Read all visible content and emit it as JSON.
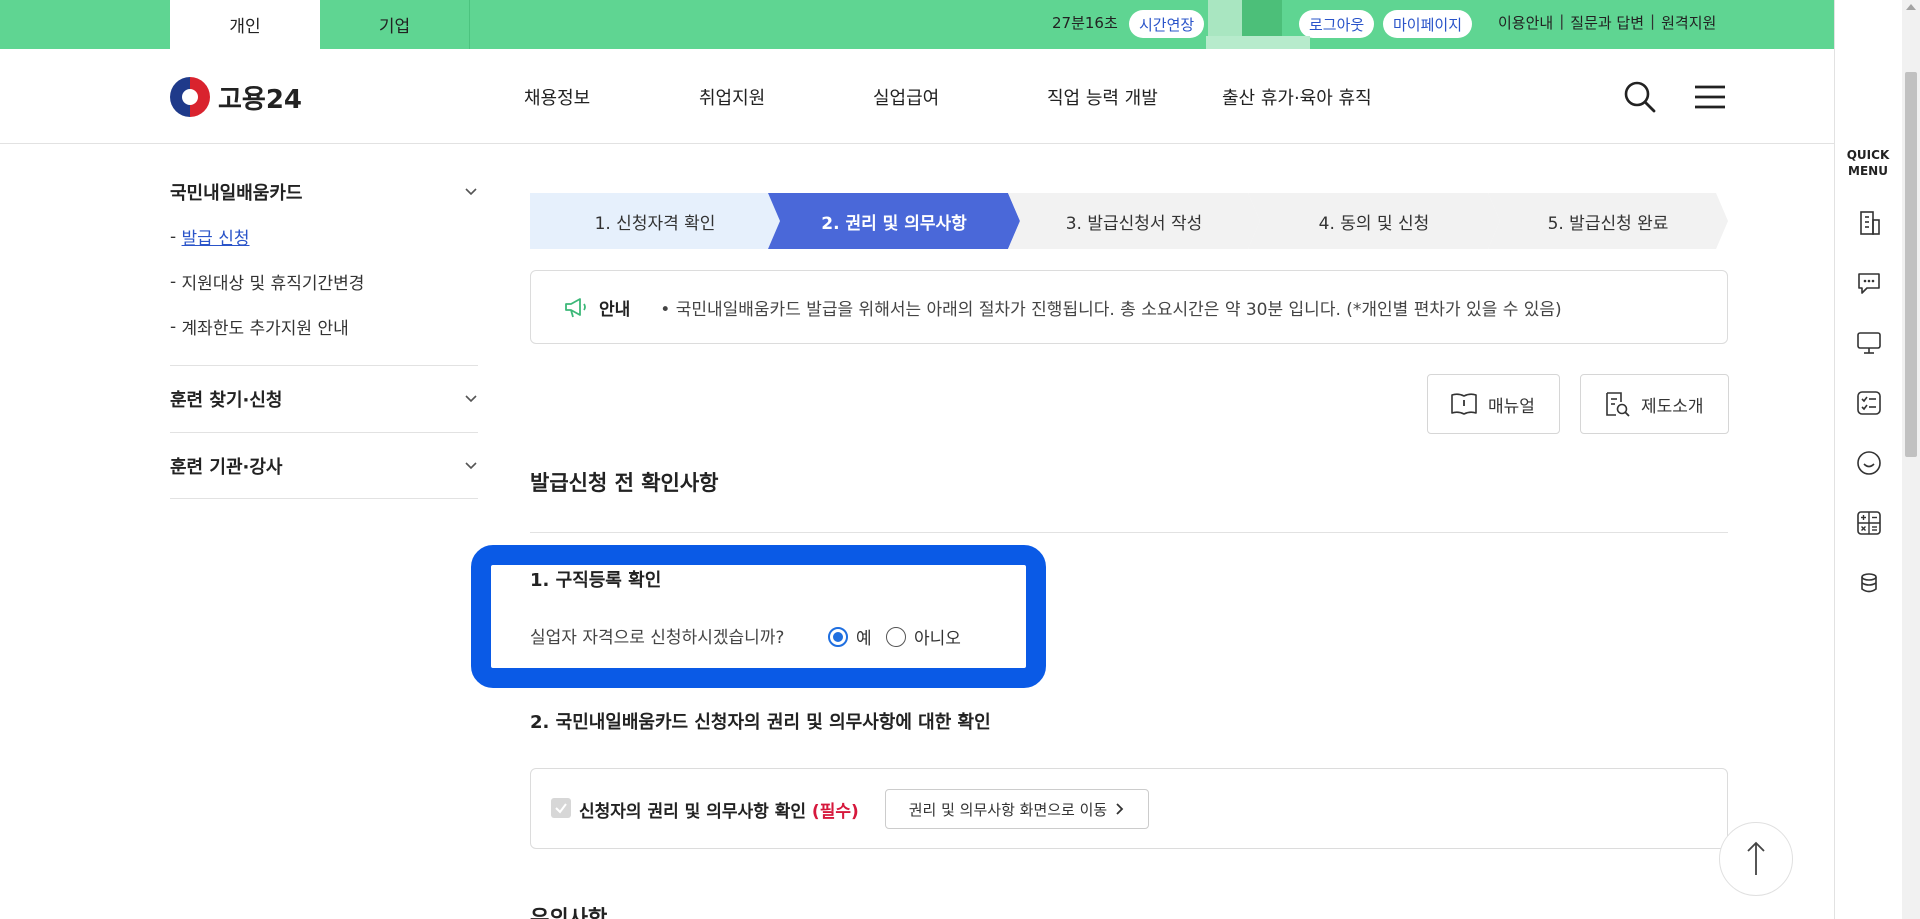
{
  "topbar": {
    "tab_personal": "개인",
    "tab_business": "기업",
    "timer": "27분16초",
    "extend_label": "시간연장",
    "logout_label": "로그아웃",
    "mypage_label": "마이페이지",
    "utility": [
      "이용안내",
      "질문과 답변",
      "원격지원"
    ]
  },
  "header": {
    "logo_text": "고용24",
    "nav": [
      "채용정보",
      "취업지원",
      "실업급여",
      "직업 능력 개발",
      "출산 휴가·육아 휴직"
    ]
  },
  "sidebar": {
    "title": "국민내일배움카드",
    "sub_items": [
      {
        "prefix": "- ",
        "label": "발급 신청"
      },
      {
        "prefix": "- ",
        "label": "지원대상 및 휴직기간변경"
      },
      {
        "prefix": "- ",
        "label": "계좌한도 추가지원 안내"
      }
    ],
    "groups": [
      "훈련 찾기·신청",
      "훈련 기관·강사"
    ]
  },
  "steps": [
    {
      "label": "1. 신청자격 확인",
      "state": "done"
    },
    {
      "label": "2. 권리 및 의무사항",
      "state": "active"
    },
    {
      "label": "3. 발급신청서 작성",
      "state": "pending"
    },
    {
      "label": "4. 동의 및 신청",
      "state": "pending"
    },
    {
      "label": "5. 발급신청 완료",
      "state": "pending"
    }
  ],
  "notice": {
    "label": "안내",
    "text": "• 국민내일배움카드 발급을 위해서는 아래의 절차가 진행됩니다. 총 소요시간은 약 30분 입니다. (*개인별 편차가 있을 수 있음)"
  },
  "buttons": {
    "manual": "매뉴얼",
    "intro": "제도소개"
  },
  "section_title": "발급신청 전 확인사항",
  "q1": {
    "title": "1. 구직등록 확인",
    "question": "실업자 자격으로 신청하시겠습니까?",
    "yes": "예",
    "no": "아니오",
    "selected": "예"
  },
  "q2": {
    "title": "2. 국민내일배움카드 신청자의 권리 및 의무사항에 대한 확인",
    "check_label": "신청자의 권리 및 의무사항 확인",
    "required": "(필수)",
    "move_button": "권리 및 의무사항 화면으로 이동"
  },
  "notes_title": "유의사항",
  "quick_menu": {
    "title_line1": "QUICK",
    "title_line2": "MENU",
    "icons": [
      "building-icon",
      "chat-icon",
      "monitor-icon",
      "checklist-icon",
      "smile-icon",
      "calculator-icon",
      "coins-icon"
    ]
  },
  "colors": {
    "topbar_green": "#5fd592",
    "step_active": "#4a68d9",
    "step_done": "#e6f0fc",
    "step_pending": "#f2f2f2",
    "highlight_blue": "#0a5ae6",
    "required_red": "#d6183c"
  }
}
